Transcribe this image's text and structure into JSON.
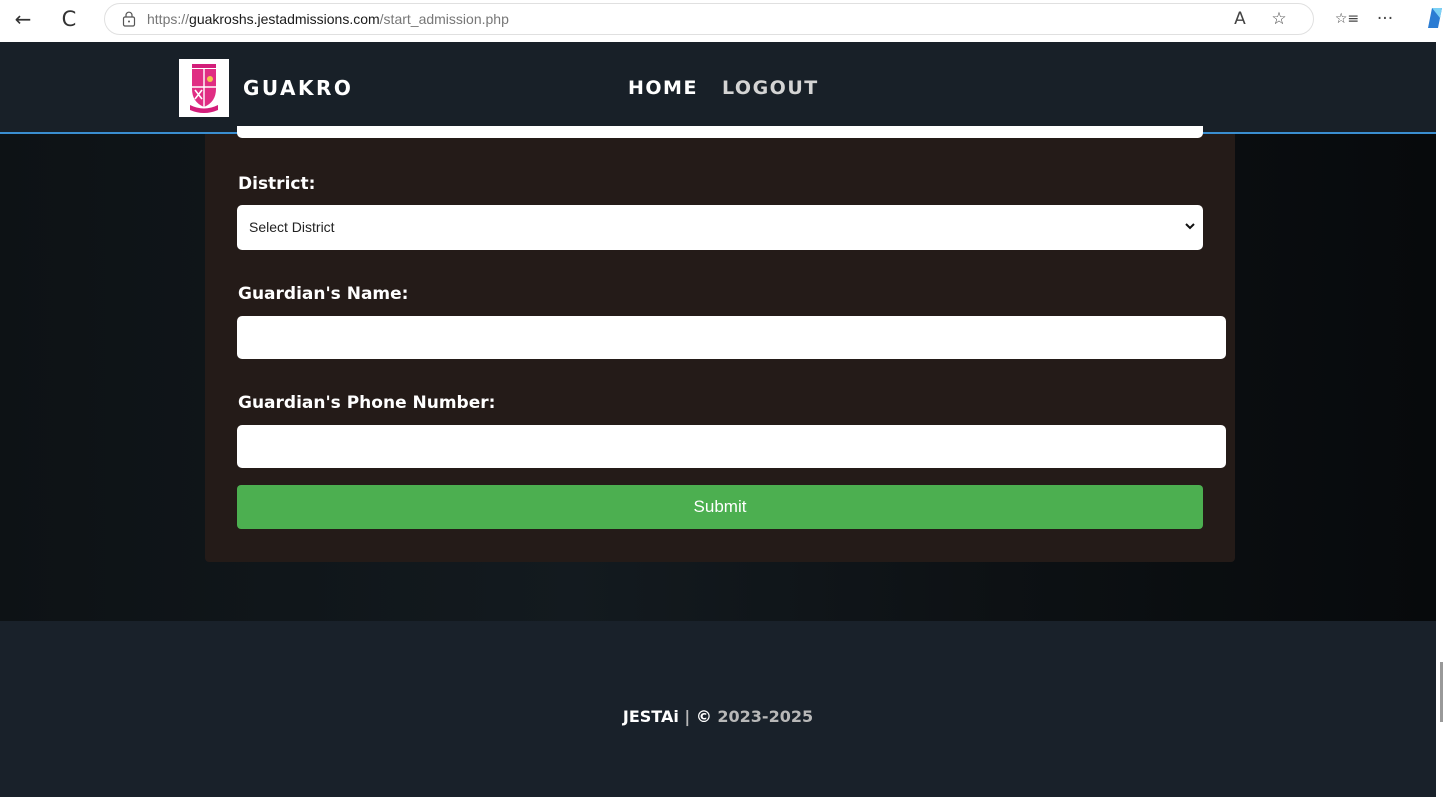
{
  "browser": {
    "url_prefix": "https://",
    "url_host": "guakroshs.jestadmissions.com",
    "url_path": "/start_admission.php",
    "back_icon": "←",
    "refresh_icon": "C",
    "read_aloud_icon": "A",
    "favorite_icon": "☆",
    "favorites_list_icon": "☆≡",
    "more_icon": "···"
  },
  "nav": {
    "brand": "GUAKRO",
    "home": "HOME",
    "logout": "LOGOUT"
  },
  "form": {
    "district_label": "District:",
    "district_selected": "Select District",
    "guardian_name_label": "Guardian's Name:",
    "guardian_name_value": "",
    "guardian_phone_label": "Guardian's Phone Number:",
    "guardian_phone_value": "",
    "submit_label": "Submit"
  },
  "footer": {
    "brand": "JESTAi",
    "separator": " | ",
    "copyright_symbol": "©",
    "years": " 2023-2025"
  },
  "colors": {
    "nav_bg": "#182028",
    "nav_border": "#3a8ed0",
    "card_bg": "#241b18",
    "submit_bg": "#4caf50",
    "footer_bg": "#19212a"
  }
}
